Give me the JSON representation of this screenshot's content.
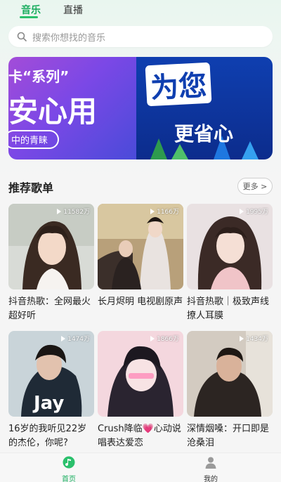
{
  "top_tabs": [
    {
      "label": "音乐"
    },
    {
      "label": "直播"
    }
  ],
  "search": {
    "placeholder": "搜索你想找的音乐"
  },
  "banner": {
    "left_line1": "卡“系列”",
    "left_line2": "安心用",
    "left_pill": "中的青睐",
    "right_line1": "为您",
    "right_line2": "更省心"
  },
  "section": {
    "title": "推荐歌单",
    "more_label": "更多 >"
  },
  "playlists": [
    {
      "title": "抖音热歌：全网最火超好听",
      "play_count": "11582万"
    },
    {
      "title": "长月烬明 电视剧原声",
      "play_count": "1166万"
    },
    {
      "title": "抖音热歌｜极致声线撩人耳膜",
      "play_count": "1995万"
    },
    {
      "title": "16岁的我听见22岁的杰伦，你呢?",
      "play_count": "1474万",
      "cover_text": "Jay"
    },
    {
      "title": "Crush降临💗心动说唱表达爱恋",
      "play_count": "1866万"
    },
    {
      "title": "深情烟嗓：开口即是沧桑泪",
      "play_count": "1434万"
    }
  ],
  "bottom_nav": [
    {
      "label": "首页",
      "icon": "music-home-icon",
      "active": true
    },
    {
      "label": "我的",
      "icon": "user-icon",
      "active": false
    }
  ],
  "colors": {
    "accent": "#1aad5f",
    "banner_right": "#0f3fb0"
  }
}
